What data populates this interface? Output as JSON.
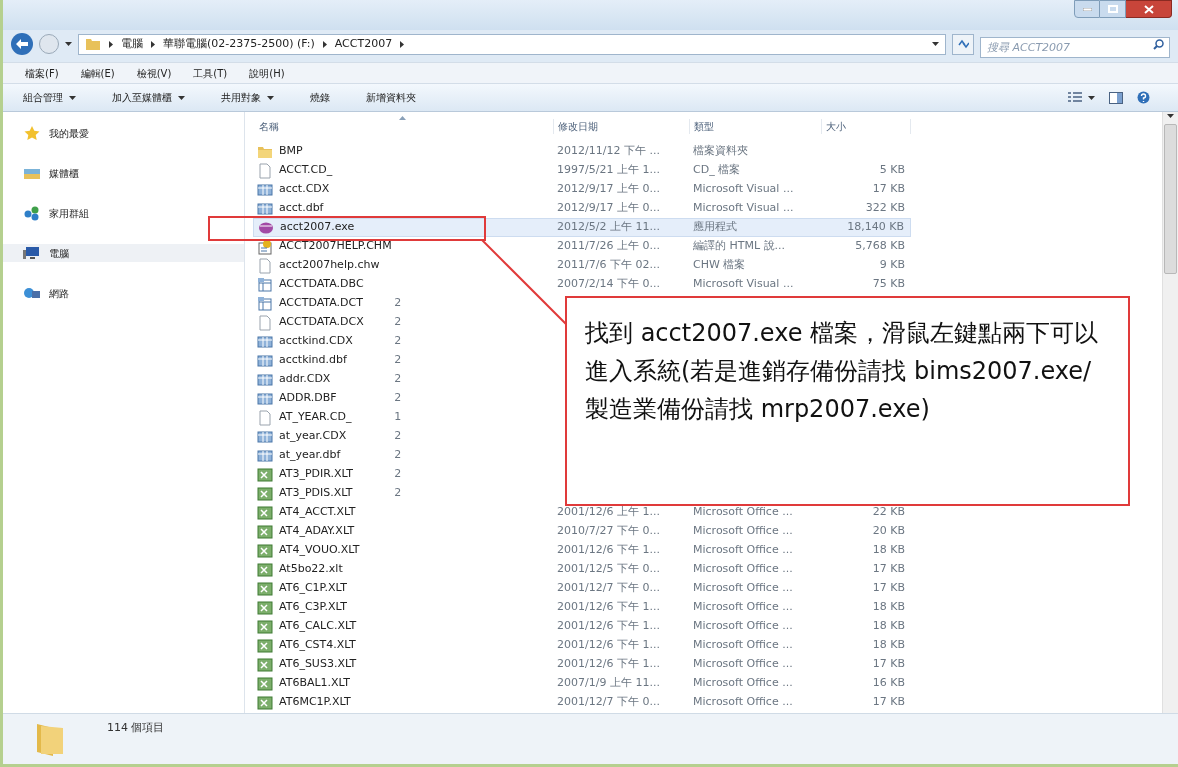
{
  "address_bar": {
    "path": [
      "電腦",
      "華聯電腦(02-2375-2500) (F:)",
      "ACCT2007"
    ]
  },
  "search": {
    "placeholder": "搜尋 ACCT2007"
  },
  "menu": [
    "檔案(F)",
    "編輯(E)",
    "檢視(V)",
    "工具(T)",
    "說明(H)"
  ],
  "toolbar": [
    {
      "label": "組合管理",
      "dropdown": true
    },
    {
      "label": "加入至媒體櫃",
      "dropdown": true
    },
    {
      "label": "共用對象",
      "dropdown": true
    },
    {
      "label": "燒錄",
      "dropdown": false
    },
    {
      "label": "新增資料夾",
      "dropdown": false
    }
  ],
  "sidebar": {
    "items": [
      {
        "label": "我的最愛",
        "kind": "favorites",
        "selected": false
      },
      {
        "label": "媒體櫃",
        "kind": "library",
        "selected": false
      },
      {
        "label": "家用群組",
        "kind": "homegroup",
        "selected": false
      },
      {
        "label": "電腦",
        "kind": "computer",
        "selected": true
      },
      {
        "label": "網路",
        "kind": "network",
        "selected": false
      }
    ]
  },
  "file_list": {
    "columns": [
      "名稱",
      "修改日期",
      "類型",
      "大小"
    ],
    "rows": [
      {
        "name": "BMP",
        "kind": "folder",
        "modified": "2012/11/12 下午 ...",
        "type": "檔案資料夾",
        "selected": false
      },
      {
        "name": "ACCT.CD_",
        "kind": "file",
        "modified": "1997/5/21 上午 1...",
        "type": "CD_ 檔案",
        "size": "5 KB",
        "selected": false
      },
      {
        "name": "acct.CDX",
        "kind": "table",
        "modified": "2012/9/17 上午 0...",
        "type": "Microsoft Visual ...",
        "size": "17 KB",
        "selected": false
      },
      {
        "name": "acct.dbf",
        "kind": "table",
        "modified": "2012/9/17 上午 0...",
        "type": "Microsoft Visual ...",
        "size": "322 KB",
        "selected": false
      },
      {
        "name": "acct2007.exe",
        "kind": "exe",
        "modified": "2012/5/2 上午 11...",
        "type": "應用程式",
        "size": "18,140 KB",
        "selected": true
      },
      {
        "name": "ACCT2007HELP.CHM",
        "kind": "help",
        "modified": "2011/7/26 上午 0...",
        "type": "編譯的 HTML 說...",
        "size": "5,768 KB",
        "selected": false
      },
      {
        "name": "acct2007help.chw",
        "kind": "file",
        "modified": "2011/7/6 下午 02...",
        "type": "CHW 檔案",
        "size": "9 KB",
        "selected": false
      },
      {
        "name": "ACCTDATA.DBC",
        "kind": "database",
        "modified": "2007/2/14 下午 0...",
        "type": "Microsoft Visual ...",
        "size": "75 KB",
        "selected": false
      },
      {
        "name": "ACCTDATA.DCT",
        "kind": "database",
        "modified": "2",
        "selected": false
      },
      {
        "name": "ACCTDATA.DCX",
        "kind": "file",
        "modified": "2",
        "selected": false
      },
      {
        "name": "acctkind.CDX",
        "kind": "table",
        "modified": "2",
        "selected": false
      },
      {
        "name": "acctkind.dbf",
        "kind": "table",
        "modified": "2",
        "selected": false
      },
      {
        "name": "addr.CDX",
        "kind": "table",
        "modified": "2",
        "selected": false
      },
      {
        "name": "ADDR.DBF",
        "kind": "table",
        "modified": "2",
        "selected": false
      },
      {
        "name": "AT_YEAR.CD_",
        "kind": "file",
        "modified": "1",
        "selected": false
      },
      {
        "name": "at_year.CDX",
        "kind": "table",
        "modified": "2",
        "selected": false
      },
      {
        "name": "at_year.dbf",
        "kind": "table",
        "modified": "2",
        "selected": false
      },
      {
        "name": "AT3_PDIR.XLT",
        "kind": "sheet",
        "modified": "2",
        "selected": false
      },
      {
        "name": "AT3_PDIS.XLT",
        "kind": "sheet",
        "modified": "2",
        "selected": false
      },
      {
        "name": "AT4_ACCT.XLT",
        "kind": "sheet",
        "modified": "2001/12/6 上午 1...",
        "type": "Microsoft Office ...",
        "size": "22 KB",
        "selected": false
      },
      {
        "name": "AT4_ADAY.XLT",
        "kind": "sheet",
        "modified": "2010/7/27 下午 0...",
        "type": "Microsoft Office ...",
        "size": "20 KB",
        "selected": false
      },
      {
        "name": "AT4_VOUO.XLT",
        "kind": "sheet",
        "modified": "2001/12/6 下午 1...",
        "type": "Microsoft Office ...",
        "size": "18 KB",
        "selected": false
      },
      {
        "name": "At5bo22.xlt",
        "kind": "sheet",
        "modified": "2001/12/5 下午 0...",
        "type": "Microsoft Office ...",
        "size": "17 KB",
        "selected": false
      },
      {
        "name": "AT6_C1P.XLT",
        "kind": "sheet",
        "modified": "2001/12/7 下午 0...",
        "type": "Microsoft Office ...",
        "size": "17 KB",
        "selected": false
      },
      {
        "name": "AT6_C3P.XLT",
        "kind": "sheet",
        "modified": "2001/12/6 下午 1...",
        "type": "Microsoft Office ...",
        "size": "18 KB",
        "selected": false
      },
      {
        "name": "AT6_CALC.XLT",
        "kind": "sheet",
        "modified": "2001/12/6 下午 1...",
        "type": "Microsoft Office ...",
        "size": "18 KB",
        "selected": false
      },
      {
        "name": "AT6_CST4.XLT",
        "kind": "sheet",
        "modified": "2001/12/6 下午 1...",
        "type": "Microsoft Office ...",
        "size": "18 KB",
        "selected": false
      },
      {
        "name": "AT6_SUS3.XLT",
        "kind": "sheet",
        "modified": "2001/12/6 下午 1...",
        "type": "Microsoft Office ...",
        "size": "17 KB",
        "selected": false
      },
      {
        "name": "AT6BAL1.XLT",
        "kind": "sheet",
        "modified": "2007/1/9 上午 11...",
        "type": "Microsoft Office ...",
        "size": "16 KB",
        "selected": false
      },
      {
        "name": "AT6MC1P.XLT",
        "kind": "sheet",
        "modified": "2001/12/7 下午 0...",
        "type": "Microsoft Office ...",
        "size": "17 KB",
        "selected": false
      }
    ]
  },
  "callout": {
    "text": "找到 acct2007.exe 檔案，滑鼠左鍵點兩下可以進入系統(若是進銷存備份請找 bims2007.exe/製造業備份請找 mrp2007.exe)"
  },
  "status_bar": {
    "count": "114 個項目"
  }
}
